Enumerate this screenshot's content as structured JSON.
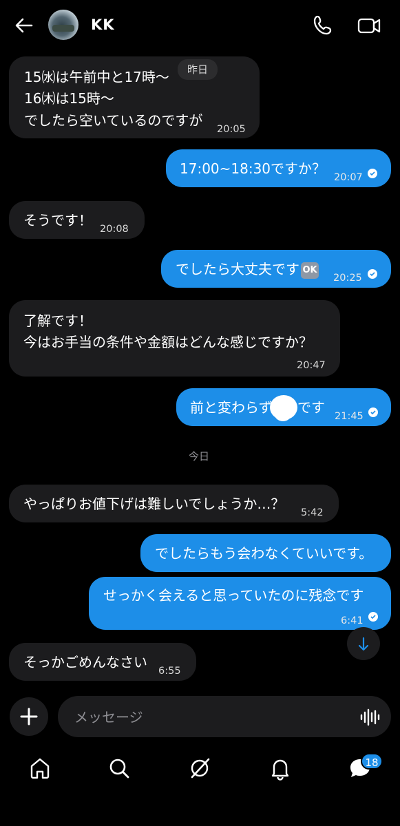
{
  "header": {
    "contact_name": "KK"
  },
  "chips": {
    "yesterday": "昨日",
    "today": "今日"
  },
  "messages": [
    {
      "side": "in",
      "lines": [
        "15㈬は午前中と17時〜",
        "16㈭は15時〜",
        "でしたら空いているのですが"
      ],
      "time": "20:05"
    },
    {
      "side": "out",
      "lines": [
        "17:00~18:30ですか？"
      ],
      "time": "20:07"
    },
    {
      "side": "in",
      "lines": [
        "そうです！"
      ],
      "time": "20:08"
    },
    {
      "side": "out",
      "lines": [
        "でしたら大丈夫です"
      ],
      "emoji": "OK",
      "time": "20:25"
    },
    {
      "side": "in",
      "lines": [
        "了解です！",
        "今はお手当の条件や金額はどんな感じですか？"
      ],
      "time": "20:47"
    },
    {
      "side": "out",
      "lines": [
        "前と変わらず",
        "です"
      ],
      "time": "21:45"
    },
    {
      "side": "in",
      "lines": [
        "やっぱりお値下げは難しいでしょうか…？"
      ],
      "time": "5:42"
    },
    {
      "side": "out",
      "lines": [
        "でしたらもう会わなくていいです。"
      ],
      "time": ""
    },
    {
      "side": "out",
      "lines": [
        "せっかく会えると思っていたのに残念です"
      ],
      "time": "6:41"
    },
    {
      "side": "in",
      "lines": [
        "そっかごめんなさい"
      ],
      "time": "6:55"
    }
  ],
  "composer": {
    "placeholder": "メッセージ"
  },
  "nav": {
    "messages_badge": "18"
  },
  "colors": {
    "outgoing": "#1d8ee8",
    "incoming": "#1c1c1e",
    "background": "#000000"
  }
}
